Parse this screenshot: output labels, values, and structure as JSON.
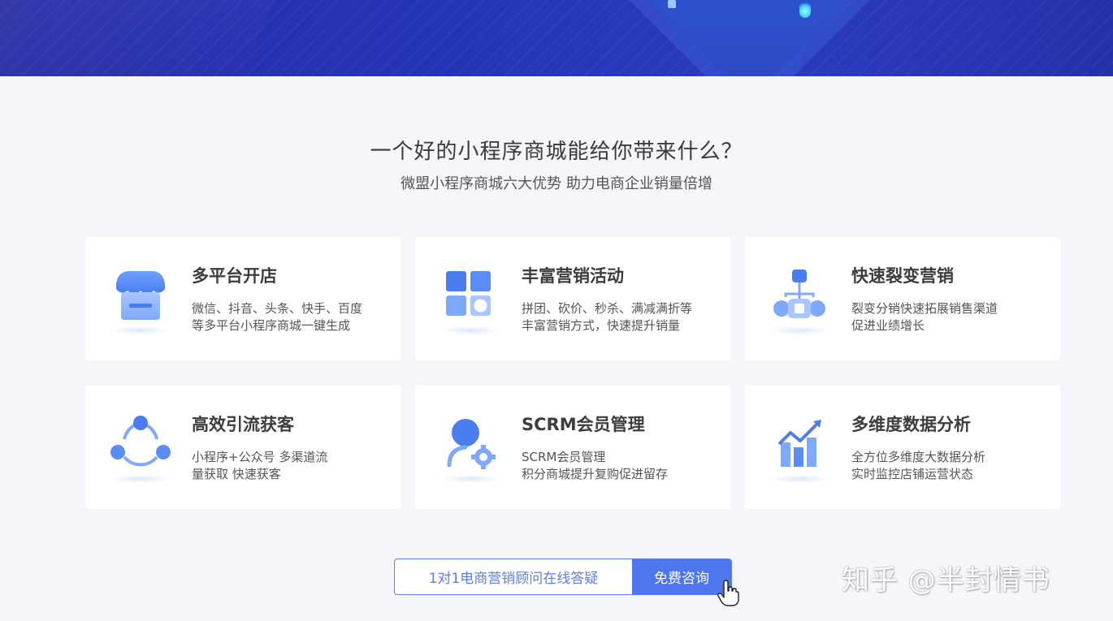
{
  "section": {
    "title": "一个好的小程序商城能给你带来什么？",
    "subtitle": "微盟小程序商城六大优势 助力电商企业销量倍增"
  },
  "features": [
    {
      "title": "多平台开店",
      "desc_line1": "微信、抖音、头条、快手、百度",
      "desc_line2": "等多平台小程序商城一键生成",
      "icon": "store-icon"
    },
    {
      "title": "丰富营销活动",
      "desc_line1": "拼团、砍价、秒杀、满减满折等",
      "desc_line2": "丰富营销方式，快速提升销量",
      "icon": "apps-grid-icon"
    },
    {
      "title": "快速裂变营销",
      "desc_line1": "裂变分销快速拓展销售渠道",
      "desc_line2": "促进业绩增长",
      "icon": "hierarchy-icon"
    },
    {
      "title": "高效引流获客",
      "desc_line1": "小程序+公众号 多渠道流",
      "desc_line2": "量获取 快速获客",
      "icon": "share-cycle-icon"
    },
    {
      "title": "SCRM会员管理",
      "desc_line1": "SCRM会员管理",
      "desc_line2": "积分商城提升复购促进留存",
      "icon": "user-gear-icon"
    },
    {
      "title": "多维度数据分析",
      "desc_line1": "全方位多维度大数据分析",
      "desc_line2": "实时监控店铺运营状态",
      "icon": "bar-trend-icon"
    }
  ],
  "cta": {
    "text": "1对1电商营销顾问在线答疑",
    "button": "免费咨询"
  },
  "watermark": "知乎 @半封情书",
  "colors": {
    "accent": "#4f76ee",
    "banner": "#2434b8",
    "icon_blue": "#5b8cf5"
  }
}
